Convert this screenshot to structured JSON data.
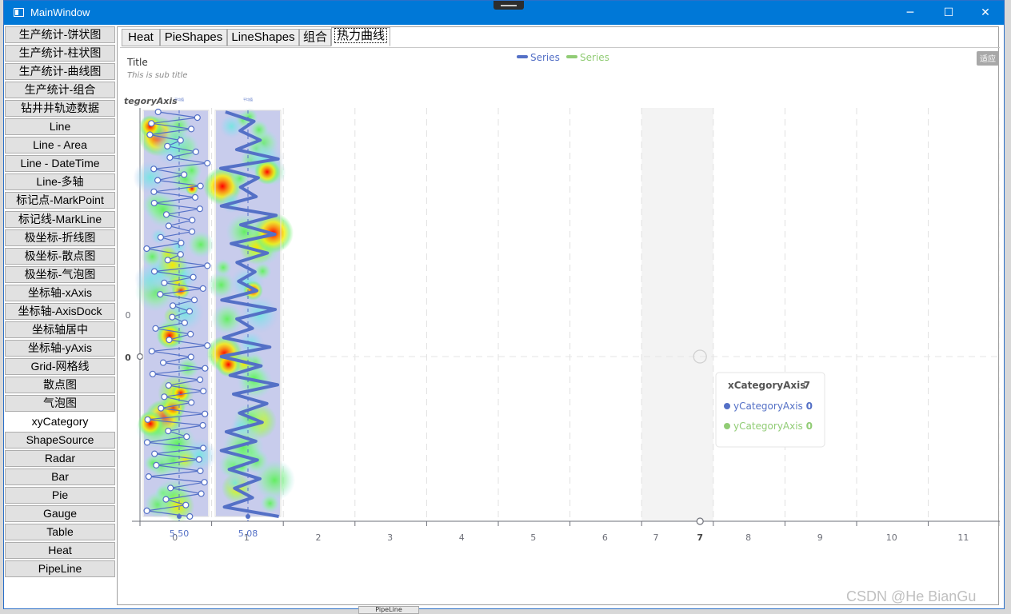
{
  "window": {
    "title": "MainWindow",
    "minimize": "─",
    "maximize": "☐",
    "close": "✕"
  },
  "menu": {
    "items": [
      "生产统计-饼状图",
      "生产统计-柱状图",
      "生产统计-曲线图",
      "生产统计-组合",
      "钻井井轨迹数据",
      "Line",
      "Line - Area",
      "Line - DateTime",
      "Line-多轴",
      "标记点-MarkPoint",
      "标记线-MarkLine",
      "极坐标-折线图",
      "极坐标-散点图",
      "极坐标-气泡图",
      "坐标轴-xAxis",
      "坐标轴-AxisDock",
      "坐标轴居中",
      "坐标轴-yAxis",
      "Grid-网格线",
      "散点图",
      "气泡图",
      "xyCategory",
      "ShapeSource",
      "Radar",
      "Bar",
      "Pie",
      "Gauge",
      "Table",
      "Heat",
      "PipeLine"
    ],
    "selected_index": 21
  },
  "tabs": [
    {
      "label": "Heat"
    },
    {
      "label": "PieShapes"
    },
    {
      "label": "LineShapes"
    },
    {
      "label": "组合"
    },
    {
      "label": "热力曲线",
      "active": true
    }
  ],
  "chart": {
    "title": "Title",
    "subtitle": "This is sub title",
    "fit_button": "适应",
    "legend": [
      {
        "name": "Series",
        "color": "#5470c6"
      },
      {
        "name": "Series",
        "color": "#91cc75"
      }
    ],
    "y_axis_name": "tegoryAxis",
    "y_axis_labels": {
      "zero": "0",
      "zero_bold": "0"
    },
    "track_headers": [
      "平均值",
      "平均值"
    ],
    "track_values": [
      "5.50",
      "5.08"
    ],
    "colors": {
      "blue": "#5470c6",
      "green": "#91cc75",
      "grid": "#e0e0e0",
      "axis": "#6e7079"
    }
  },
  "chart_data": {
    "type": "line",
    "x_axis": {
      "name": "xCategoryAxis",
      "categories": [
        "0",
        "1",
        "2",
        "3",
        "4",
        "5",
        "6",
        "7",
        "8",
        "9",
        "10",
        "11"
      ],
      "highlighted": "7"
    },
    "y_axis": {
      "name": "yCategoryAxis"
    },
    "series": [
      {
        "name": "Series",
        "color": "#5470c6"
      },
      {
        "name": "Series",
        "color": "#91cc75"
      }
    ],
    "tooltip": {
      "header": "xCategoryAxis",
      "header_value": "7",
      "rows": [
        {
          "label": "yCategoryAxis",
          "value": "0",
          "color": "#5470c6"
        },
        {
          "label": "yCategoryAxis",
          "value": "0",
          "color": "#91cc75"
        }
      ]
    }
  },
  "watermark": "CSDN @He BianGu",
  "underlying_window_label": "PipeLine"
}
